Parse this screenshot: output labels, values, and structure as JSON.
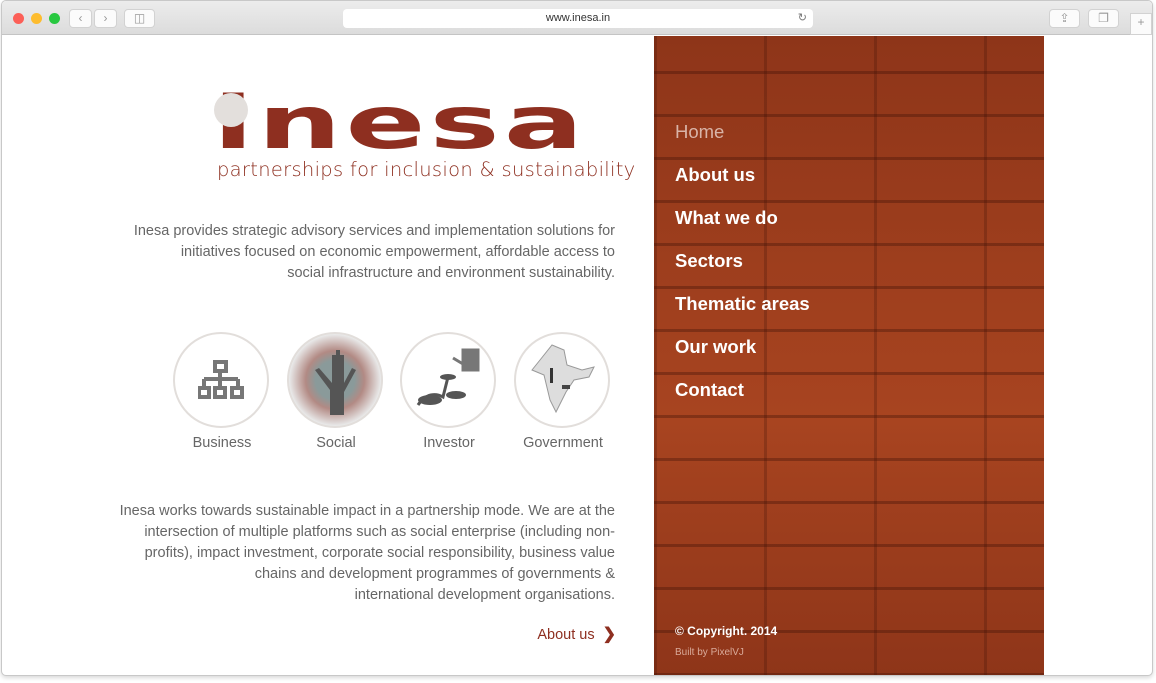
{
  "browser": {
    "url": "www.inesa.in"
  },
  "logo": {
    "text": "inesa",
    "tagline": "partnerships for inclusion & sustainability"
  },
  "intro": "Inesa provides strategic advisory services and implementation solutions for initiatives focused on economic empowerment, affordable access to social infrastructure and environment sustainability.",
  "intro_lines": [
    "Inesa provides strategic advisory services and implementation solutions for",
    "initiatives focused on economic empowerment, affordable access to",
    "social infrastructure and environment sustainability."
  ],
  "categories": [
    {
      "label": "Business",
      "icon": "org-chart-icon"
    },
    {
      "label": "Social",
      "icon": "hand-tree-icon"
    },
    {
      "label": "Investor",
      "icon": "watering-can-plant-icon"
    },
    {
      "label": "Government",
      "icon": "india-map-icon"
    }
  ],
  "body_lines": [
    "Inesa works towards sustainable impact in a partnership mode. We are at the",
    "intersection of multiple platforms such as social enterprise (including non-",
    "profits), impact investment, corporate social responsibility, business value",
    "chains and development programmes of governments &",
    "international development organisations."
  ],
  "more_link": "About us",
  "nav": [
    {
      "label": "Home",
      "active": true
    },
    {
      "label": "About us"
    },
    {
      "label": "What we do"
    },
    {
      "label": "Sectors"
    },
    {
      "label": "Thematic areas"
    },
    {
      "label": "Our work"
    },
    {
      "label": "Contact"
    }
  ],
  "footer": {
    "copyright": "© Copyright. 2014",
    "built_by": "Built by PixelVJ"
  },
  "colors": {
    "brand": "#8e2f20",
    "panel": "#9b3a1d"
  }
}
